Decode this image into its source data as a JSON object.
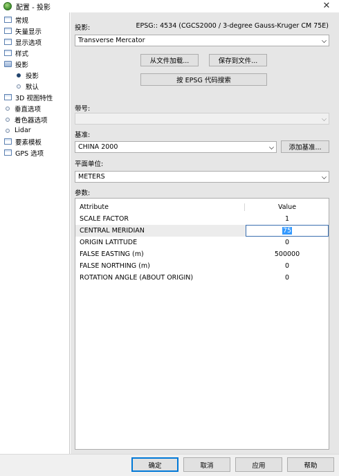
{
  "window": {
    "title": "配置 - 投影",
    "close_glyph": "✕"
  },
  "tree": {
    "items": [
      {
        "label": "常规",
        "icon": "form-icon"
      },
      {
        "label": "矢量显示",
        "icon": "form-icon"
      },
      {
        "label": "显示选项",
        "icon": "form-icon"
      },
      {
        "label": "样式",
        "icon": "form-icon"
      },
      {
        "label": "投影",
        "icon": "folder-icon"
      },
      {
        "label": "投影",
        "icon": "dot-icon",
        "child": true,
        "selected": true
      },
      {
        "label": "默认",
        "icon": "dot-icon",
        "child": true
      },
      {
        "label": "3D 视图特性",
        "icon": "form-icon"
      },
      {
        "label": "垂直选项",
        "icon": "dot-icon"
      },
      {
        "label": "着色器选项",
        "icon": "dot-icon"
      },
      {
        "label": "Lidar",
        "icon": "dot-icon"
      },
      {
        "label": "要素模板",
        "icon": "form-icon"
      },
      {
        "label": "GPS 选项",
        "icon": "form-icon"
      }
    ]
  },
  "projection": {
    "label": "投影:",
    "epsg_text": "EPSG:: 4534 (CGCS2000 / 3-degree Gauss-Kruger CM 75E)",
    "value": "Transverse Mercator",
    "load_from_file": "从文件加载...",
    "save_to_file": "保存到文件...",
    "search_epsg": "按 EPSG 代码搜索"
  },
  "zone": {
    "label": "带号:",
    "value": ""
  },
  "datum": {
    "label": "基准:",
    "value": "CHINA 2000",
    "add_datum": "添加基准..."
  },
  "planar_units": {
    "label": "平面单位:",
    "value": "METERS"
  },
  "parameters": {
    "label": "参数:",
    "header_attribute": "Attribute",
    "header_value": "Value",
    "rows": [
      {
        "attribute": "SCALE FACTOR",
        "value": "1"
      },
      {
        "attribute": "CENTRAL MERIDIAN",
        "value": "75"
      },
      {
        "attribute": "ORIGIN LATITUDE",
        "value": "0"
      },
      {
        "attribute": "FALSE EASTING (m)",
        "value": "500000"
      },
      {
        "attribute": "FALSE NORTHING (m)",
        "value": "0"
      },
      {
        "attribute": "ROTATION ANGLE (ABOUT ORIGIN)",
        "value": "0"
      }
    ]
  },
  "buttons": {
    "ok": "确定",
    "cancel": "取消",
    "apply": "应用",
    "help": "帮助"
  },
  "colors": {
    "panel_bg": "#e6e6e6",
    "selection": "#3399ff",
    "focus_border": "#0078d7"
  }
}
